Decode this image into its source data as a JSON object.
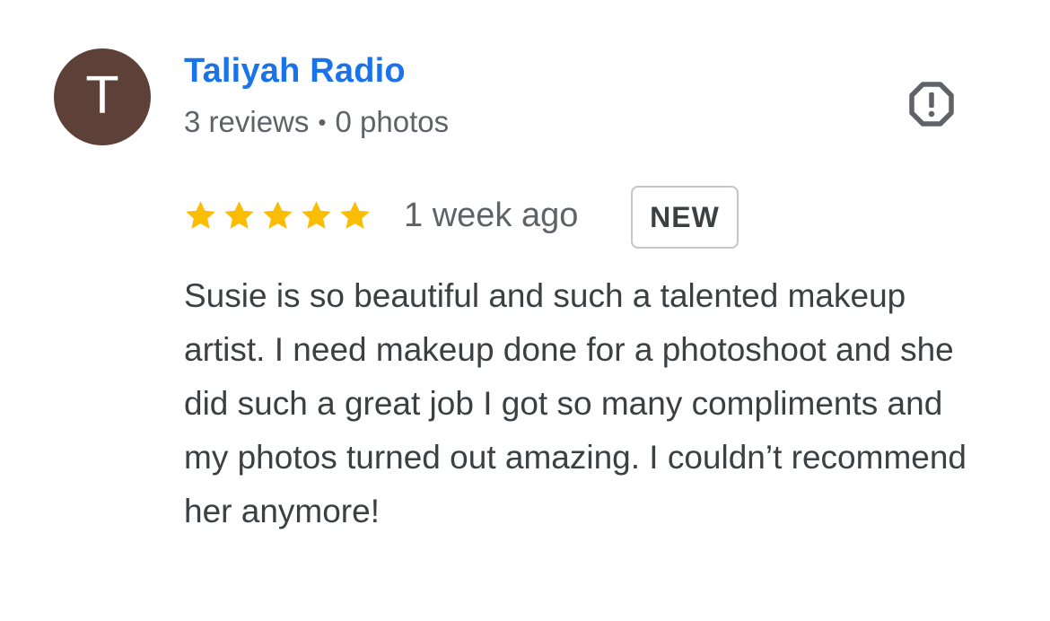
{
  "author": {
    "initial": "T",
    "name": "Taliyah Radio",
    "reviews": "3 reviews",
    "separator": "•",
    "photos": "0 photos",
    "avatar_color": "#5d4037",
    "name_color": "#1a73e8"
  },
  "actions": {
    "report_icon": "report-flag-icon"
  },
  "review": {
    "rating": 5,
    "rating_max": 5,
    "star_color": "#fbbc04",
    "time": "1 week ago",
    "badge": "NEW",
    "text": "Susie is so beautiful and such a talented makeup artist. I need makeup done for a photoshoot and she did such a great job I got so many compliments and my photos turned out amazing. I couldn’t recommend her anymore!"
  }
}
